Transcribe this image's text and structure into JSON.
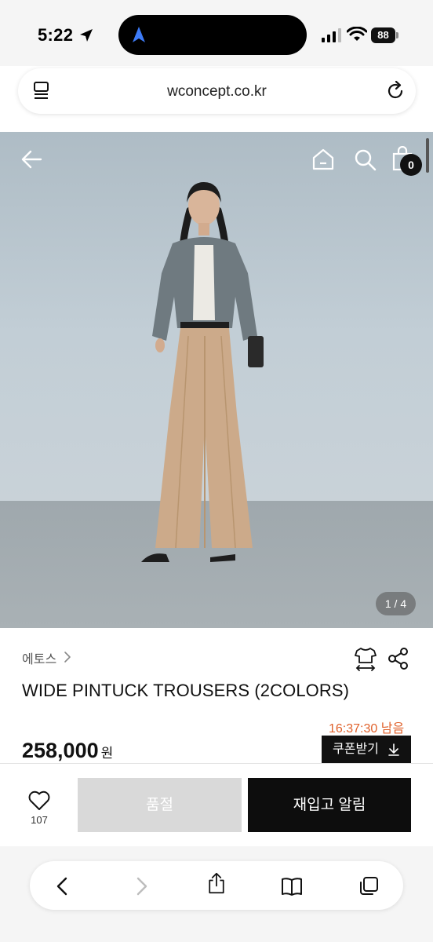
{
  "status_bar": {
    "time": "5:22",
    "battery": "88"
  },
  "browser": {
    "url": "wconcept.co.kr"
  },
  "hero": {
    "image_counter": "1 / 4",
    "cart_count": "0"
  },
  "product": {
    "brand": "에토스",
    "name": "WIDE PINTUCK TROUSERS (2COLORS)",
    "timer": "16:37:30 남음",
    "price": "258,000",
    "price_unit": "원",
    "coupon_label": "쿠폰받기"
  },
  "actions": {
    "wish_count": "107",
    "soldout_label": "품절",
    "restock_label": "재입고 알림"
  },
  "colors": {
    "accent_timer": "#e0612b",
    "primary_button": "#0d0d0d",
    "disabled_button": "#d9d9d9"
  },
  "icons": {
    "status": [
      "location-arrow-icon",
      "signal-icon",
      "wifi-icon",
      "battery-icon"
    ],
    "hero": [
      "back-arrow-icon",
      "home-icon",
      "search-icon",
      "shopping-bag-icon"
    ],
    "product": [
      "chevron-right-icon",
      "size-guide-icon",
      "share-icon",
      "download-icon",
      "heart-icon"
    ],
    "safari": [
      "back-icon",
      "forward-icon",
      "share-icon",
      "bookmarks-icon",
      "tabs-icon"
    ]
  }
}
